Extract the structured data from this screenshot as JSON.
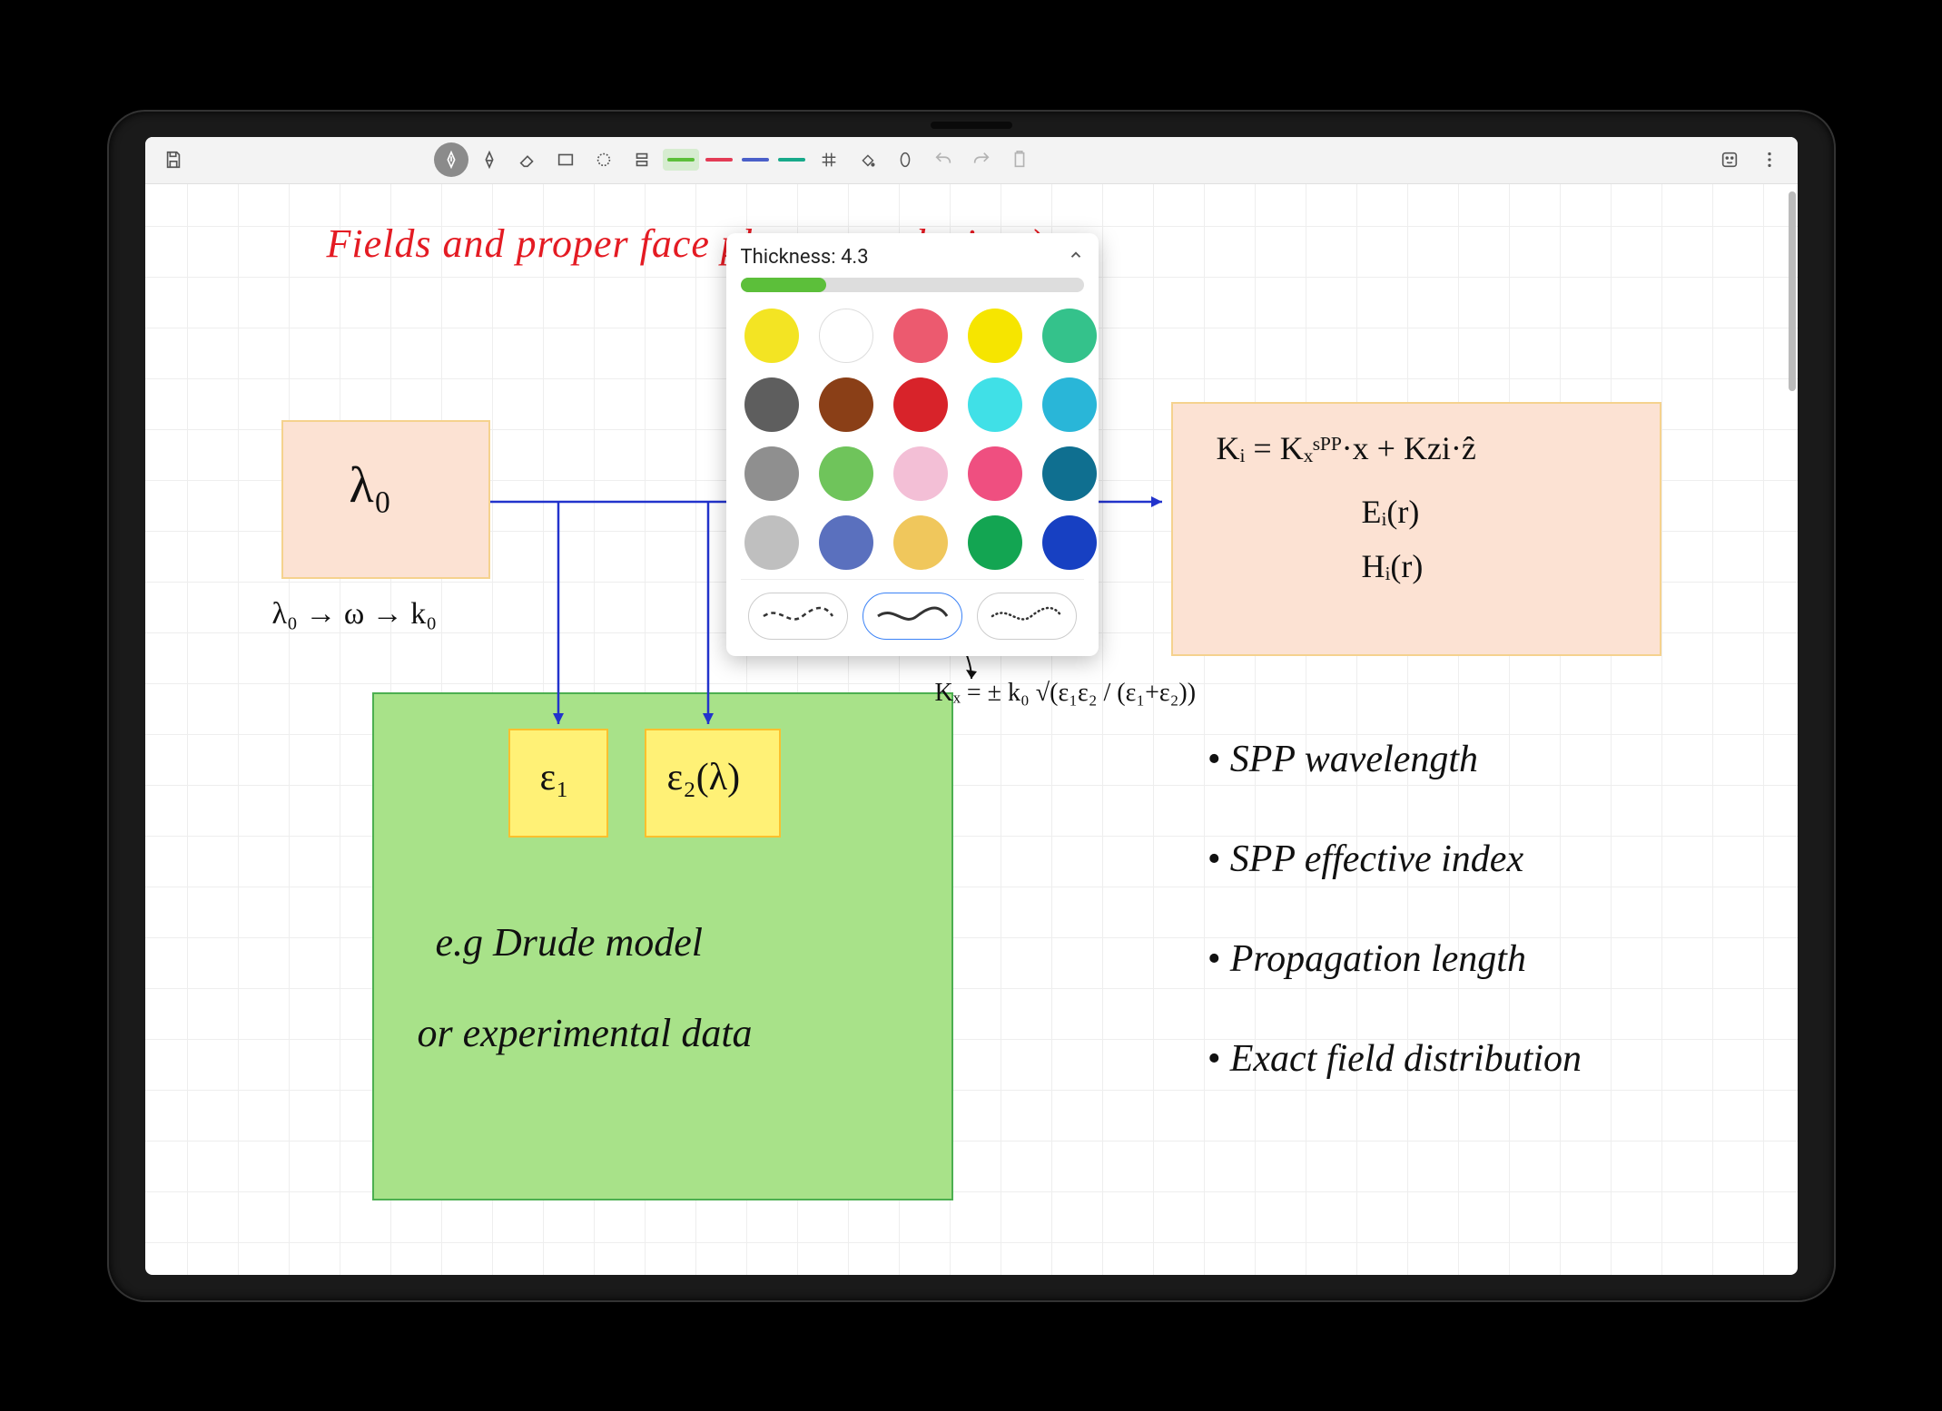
{
  "toolbar": {
    "swatches": [
      {
        "color": "#5cbf3a",
        "active": true
      },
      {
        "color": "#e33b55",
        "active": false
      },
      {
        "color": "#4a5fc9",
        "active": false
      },
      {
        "color": "#17a98a",
        "active": false
      }
    ]
  },
  "popup": {
    "thickness_label": "Thickness: 4.3",
    "thickness_value": 4.3,
    "slider_percent": 25,
    "colors": [
      "#f3e423",
      "#ffffff",
      "#ec5a6f",
      "#f6e500",
      "#34c28b",
      "#5e5e5e",
      "#8a3f17",
      "#d8232a",
      "#40e0e7",
      "#29b6d8",
      "#8f8f8f",
      "#6fc45b",
      "#f3bfd6",
      "#ef4f80",
      "#0f6f90",
      "#bfbfbf",
      "#5a70be",
      "#f0c75c",
      "#13a552",
      "#1740c2"
    ],
    "selected_stroke_index": 1
  },
  "notes": {
    "title": "Fields and proper                        face plasmon polariton)",
    "lambda0": "λ₀",
    "lambda_chain": "λ₀ → ω → k₀",
    "eps1": "ε₁",
    "eps2": "ε₂(λ)",
    "drude1": "e.g  Drude model",
    "drude2": "or  experimental data",
    "kx": "Kₓ = ± k₀ √(ε₁ε₂ / (ε₁+ε₂))",
    "ki": "Kᵢ = Kₓˢᴾᴾ·x + Kzi·ẑ",
    "ei": "Eᵢ(r)",
    "hi": "Hᵢ(r)",
    "bullets": [
      "• SPP wavelength",
      "• SPP effective index",
      "• Propagation length",
      "• Exact field distribution"
    ]
  }
}
